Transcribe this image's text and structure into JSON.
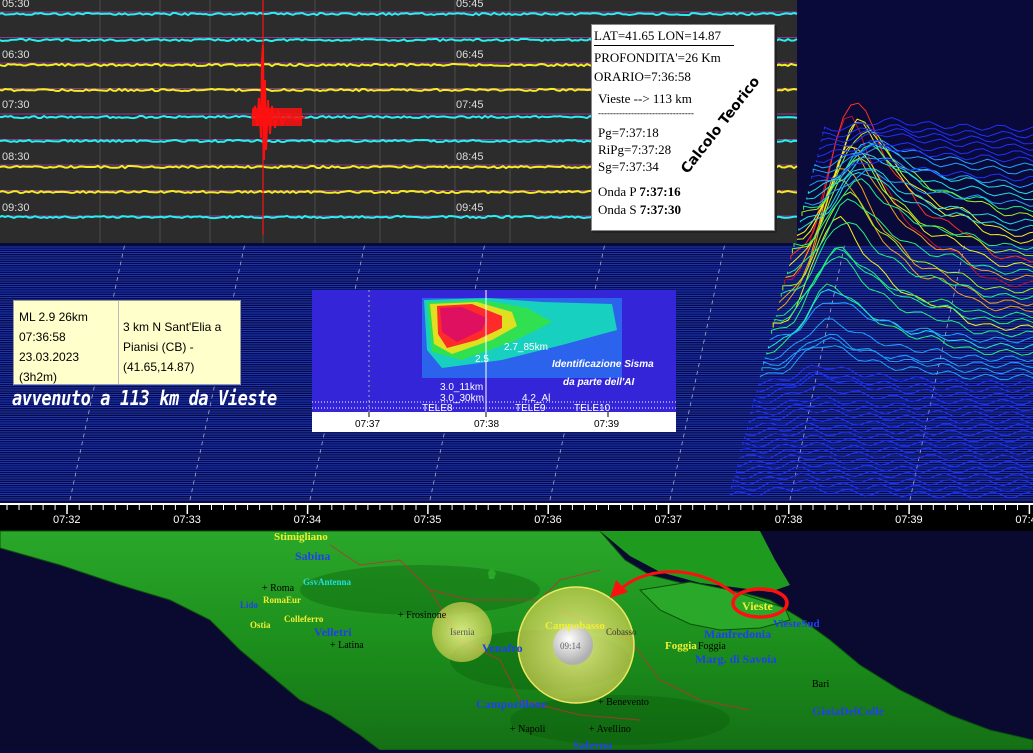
{
  "helicorder": {
    "left_times": [
      "05:30",
      "06:30",
      "07:30",
      "08:30",
      "09:30"
    ],
    "right_times": [
      "05:45",
      "06:45",
      "07:45",
      "08:45",
      "09:45"
    ]
  },
  "theoretical": {
    "lat_lon": "LAT=41.65 LON=14.87",
    "depth": "PROFONDITA'=26 Km",
    "time": "ORARIO=7:36:58",
    "distance": "Vieste --> 113 km",
    "separator": "--------------------------------",
    "pg": "Pg=7:37:18",
    "ripg": "RiPg=7:37:28",
    "sg": "Sg=7:37:34",
    "p_label": "Onda P",
    "p_value": "7:37:16",
    "s_label": "Onda S",
    "s_value": "7:37:30",
    "stamp": "Calcolo Teorico"
  },
  "event": {
    "magnitude_depth": "ML 2.9 26km",
    "time": "07:36:58",
    "date": "23.03.2023",
    "elapsed": "(3h2m)",
    "location": "3 km N Sant'Elia a Pianisi (CB) - (41.65,14.87)"
  },
  "headline": "avvenuto a 113 km da Vieste",
  "spectrogram": {
    "annotations": [
      "2.7_85km",
      "2.5",
      "3.0_11km",
      "3.0_30km",
      "4.2_Al"
    ],
    "teles": [
      "TELE8",
      "TELE9",
      "TELE10"
    ],
    "ai_line1": "Identificazione Sisma",
    "ai_line2": "da parte dell'AI",
    "time_ticks": [
      "07:37",
      "07:38",
      "07:39"
    ]
  },
  "timeline": {
    "ticks": [
      "07:32",
      "07:33",
      "07:34",
      "07:35",
      "07:36",
      "07:37",
      "07:38",
      "07:39",
      "07:4"
    ]
  },
  "map": {
    "labels_yellow": [
      "Stimigliano",
      "RomaEur",
      "Colleferro",
      "Ostia",
      "Campobasso",
      "Foggia",
      "Vieste"
    ],
    "labels_blue": [
      "Sabina",
      "Velletri",
      "Venafro",
      "Campozillone",
      "Manfredonia",
      "Marg. di Savoia",
      "ViesteSud",
      "GioiaDelColle",
      "Salerno",
      "Lido"
    ],
    "labels_cyan": [
      "GsvAntenna"
    ],
    "labels_black": [
      "+ Roma",
      "+ Latina",
      "+ Frosinone",
      "+ Benevento",
      "+ Napoli",
      "+ Avellino",
      "Foggia",
      "Bari",
      "Isernia",
      "Cobasso"
    ],
    "marker_time": "09:14",
    "colors": {
      "sea": "#0a0a30",
      "land": "#1e9a1e",
      "quake_circle": "#e8e070",
      "vieste_ring": "#ff0000"
    }
  },
  "colors": {
    "helicorder_bg": "#2c2c2c",
    "trace_cyan": "#28f0f0",
    "trace_yellow": "#f0f020",
    "quake_trace": "#ff1010",
    "waterfall_bg": "#0a0a3a"
  }
}
